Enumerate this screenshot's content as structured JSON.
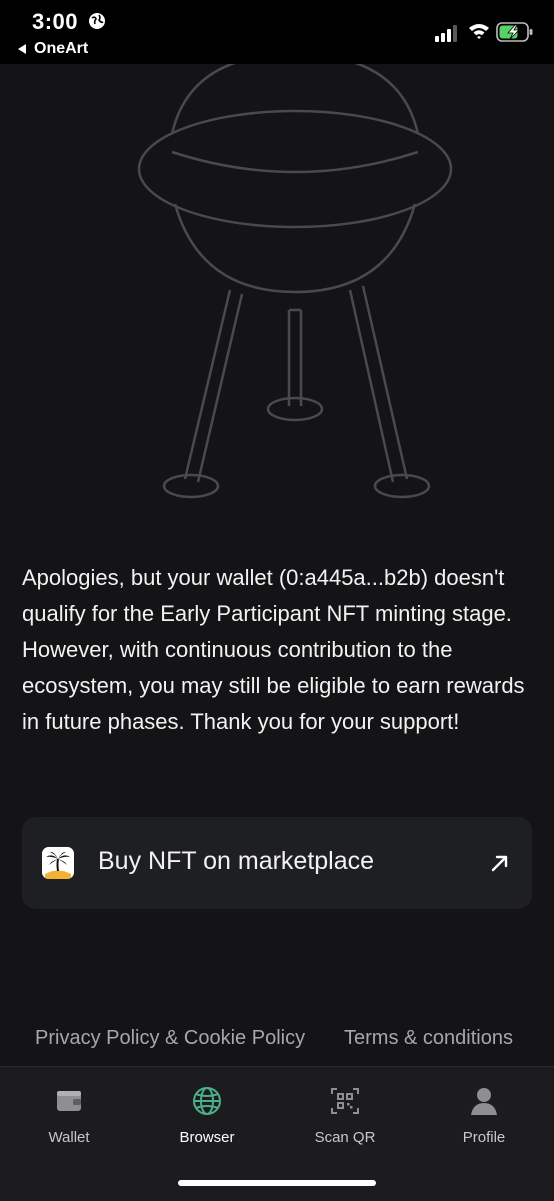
{
  "status": {
    "time": "3:00",
    "back_label": "OneArt"
  },
  "message": "Apologies, but your wallet (0:a445a...b2b) doesn't qualify for the Early Participant NFT minting stage. However, with continuous contribution to the ecosystem, you may still be eligible to earn rewards in future phases. Thank you for your support!",
  "market_button": {
    "label": "Buy NFT on marketplace",
    "icon": "palm-island-icon"
  },
  "footer": {
    "privacy": "Privacy Policy & Cookie Policy",
    "terms": "Terms & conditions"
  },
  "tabs": [
    {
      "label": "Wallet",
      "icon": "wallet-icon",
      "active": false
    },
    {
      "label": "Browser",
      "icon": "globe-icon",
      "active": true
    },
    {
      "label": "Scan QR",
      "icon": "qr-scan-icon",
      "active": false
    },
    {
      "label": "Profile",
      "icon": "profile-icon",
      "active": false
    }
  ],
  "colors": {
    "background": "#141416",
    "card": "#1e1f22",
    "tab_bar": "#1c1c1e",
    "accent_browser": "#4caf8a"
  }
}
